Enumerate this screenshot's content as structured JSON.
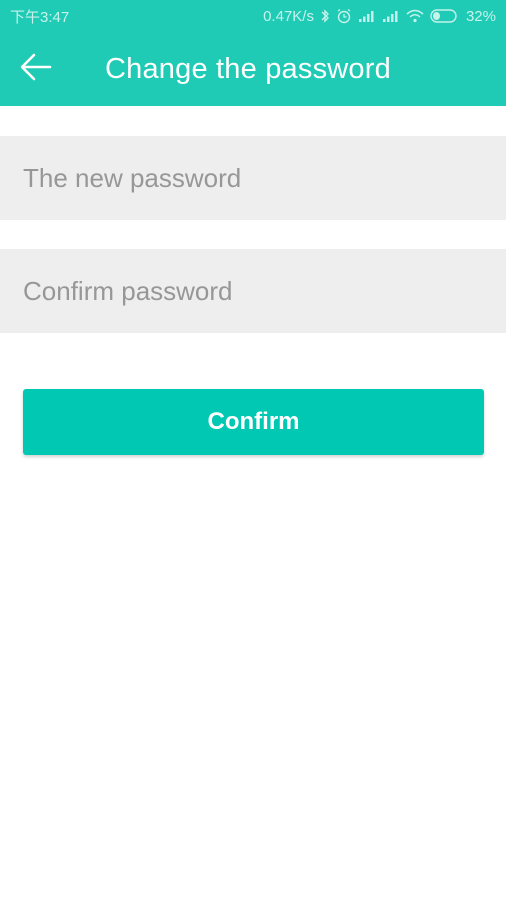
{
  "status_bar": {
    "time": "下午3:47",
    "network_speed": "0.47K/s",
    "battery": "32%",
    "icons": [
      "bluetooth-icon",
      "alarm-icon",
      "signal-icon",
      "signal-icon",
      "wifi-icon",
      "battery-icon"
    ]
  },
  "app_bar": {
    "title": "Change the password",
    "back_icon": "arrow-left-icon",
    "color": "#1fcbb4"
  },
  "form": {
    "new_password": {
      "placeholder": "The new password",
      "value": ""
    },
    "confirm_password": {
      "placeholder": "Confirm password",
      "value": ""
    },
    "confirm_button_label": "Confirm",
    "button_color": "#01c8b2",
    "field_background": "#efeeef"
  }
}
